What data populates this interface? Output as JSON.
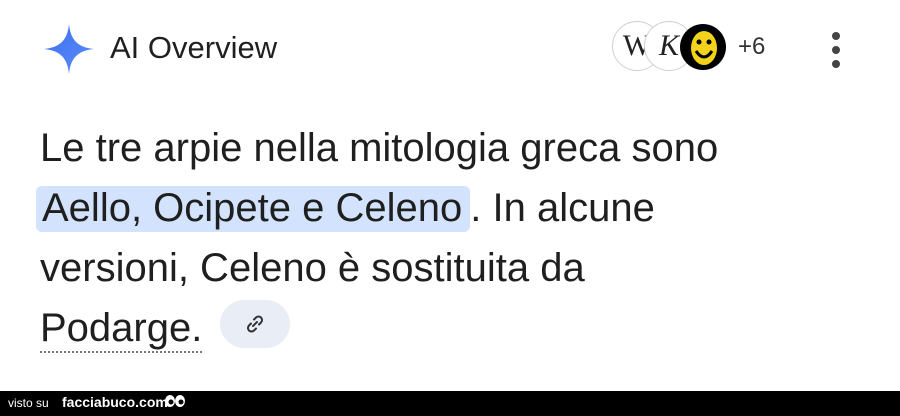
{
  "header": {
    "title": "AI Overview",
    "sources": [
      {
        "label": "W",
        "icon": "wikipedia-icon"
      },
      {
        "label": "K",
        "icon": "source-k-icon"
      },
      {
        "label": "",
        "icon": "smiley-source-icon"
      }
    ],
    "more_sources": "+6",
    "menu_icon": "more-vert-icon"
  },
  "answer": {
    "line1": "Le tre arpie nella mitologia greca sono",
    "highlight": "Aello, Ocipete e Celeno",
    "line2_rest": ". In alcune",
    "line3": "versioni, Celeno è sostituita da",
    "line4": "Podarge.",
    "link_icon": "link-icon"
  },
  "footer": {
    "prefix": "visto su",
    "site": "facciabuco.com"
  },
  "colors": {
    "highlight": "#d3e3fd",
    "spark": "#4a7bf7",
    "chip": "#e9eef6"
  }
}
